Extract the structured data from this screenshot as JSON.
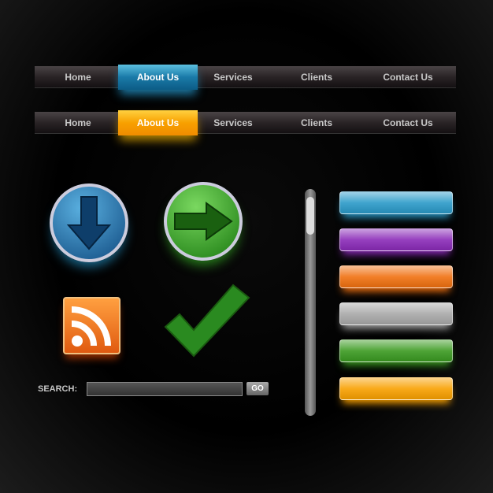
{
  "nav_blue": {
    "items": [
      "Home",
      "About Us",
      "Services",
      "Clients",
      "Contact Us"
    ],
    "active": "About Us",
    "accent": "#1a7aa8"
  },
  "nav_orange": {
    "items": [
      "Home",
      "About Us",
      "Services",
      "Clients",
      "Contact Us"
    ],
    "active": "About Us",
    "accent": "#f8a000"
  },
  "icons": [
    "download-arrow-icon",
    "right-arrow-icon",
    "rss-icon",
    "checkmark-icon"
  ],
  "search": {
    "label": "SEARCH:",
    "value": "",
    "button": "GO"
  },
  "buttons": [
    {
      "color": "#2a9ac8"
    },
    {
      "color": "#8a2ab8"
    },
    {
      "color": "#f07010"
    },
    {
      "color": "#a8a8a8"
    },
    {
      "color": "#3a9a20"
    },
    {
      "color": "#f8a000"
    }
  ]
}
